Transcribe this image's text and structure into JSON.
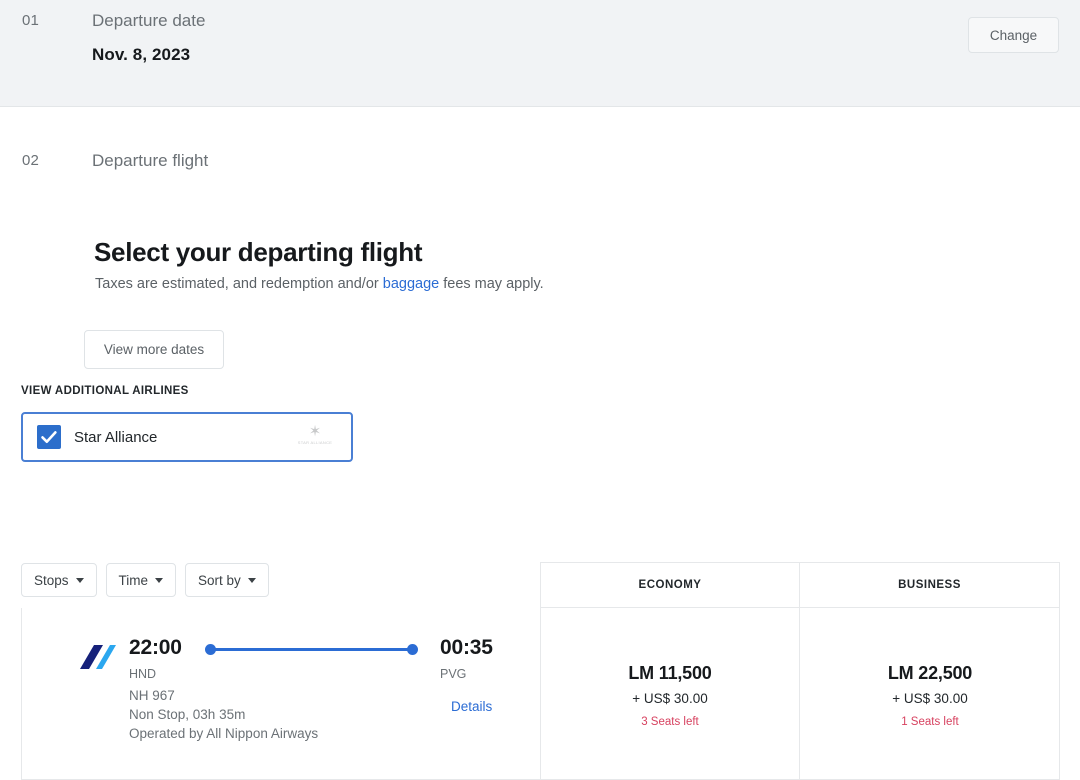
{
  "steps": {
    "date": {
      "number": "01",
      "label": "Departure date",
      "value": "Nov. 8, 2023",
      "change_label": "Change"
    },
    "flight": {
      "number": "02",
      "label": "Departure flight",
      "headline": "Select your departing flight",
      "subline_before": "Taxes are estimated, and redemption and/or ",
      "subline_link": "baggage",
      "subline_after": " fees may apply.",
      "view_more_dates_label": "View more dates"
    }
  },
  "airlines_filter": {
    "section_label": "VIEW ADDITIONAL AIRLINES",
    "alliance_name": "Star Alliance",
    "alliance_logo_word": "STAR ALLIANCE",
    "checked": true,
    "checkbox_color": "#2c6ecb",
    "card_border_color": "#4a7fd4"
  },
  "filters": [
    {
      "label": "Stops"
    },
    {
      "label": "Time"
    },
    {
      "label": "Sort by"
    }
  ],
  "fare_columns": [
    {
      "label": "ECONOMY"
    },
    {
      "label": "BUSINESS"
    }
  ],
  "flights": [
    {
      "depart_time": "22:00",
      "depart_code": "HND",
      "arrive_time": "00:35",
      "arrive_code": "PVG",
      "flight_number": "NH 967",
      "stops_duration": "Non Stop, 03h 35m",
      "operated_by": "Operated by All Nippon Airways",
      "details_label": "Details",
      "logo_dark_color": "#16217a",
      "logo_light_color": "#2ba7ef",
      "path_color": "#2b6cd4",
      "fares": [
        {
          "cabin": "ECONOMY",
          "miles": "LM 11,500",
          "tax": "+ US$ 30.00",
          "seats_left": "3 Seats left"
        },
        {
          "cabin": "BUSINESS",
          "miles": "LM 22,500",
          "tax": "+ US$ 30.00",
          "seats_left": "1 Seats left"
        }
      ]
    }
  ],
  "colors": {
    "link": "#2b6cd4",
    "alert": "#d7415f",
    "step_bg": "#f1f3f5"
  }
}
